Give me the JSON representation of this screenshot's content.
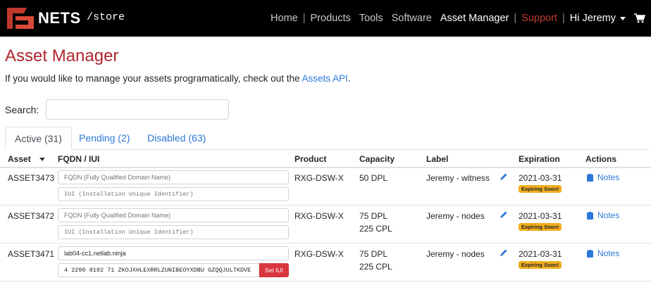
{
  "brand": {
    "logo_text": "NETS",
    "path": "/store"
  },
  "nav": {
    "home": "Home",
    "products": "Products",
    "tools": "Tools",
    "software": "Software",
    "asset_manager": "Asset Manager",
    "support": "Support",
    "user": "Hi Jeremy"
  },
  "page": {
    "title": "Asset Manager",
    "intro_prefix": "If you would like to manage your assets programatically, check out the ",
    "intro_link": "Assets API",
    "intro_suffix": "."
  },
  "search": {
    "label": "Search:",
    "placeholder": "",
    "value": ""
  },
  "tabs": [
    {
      "label": "Active (31)",
      "active": true
    },
    {
      "label": "Pending (2)",
      "active": false
    },
    {
      "label": "Disabled (63)",
      "active": false
    }
  ],
  "table": {
    "headers": {
      "asset": "Asset",
      "fqdn_iui": "FQDN / IUI",
      "product": "Product",
      "capacity": "Capacity",
      "label": "Label",
      "expiration": "Expiration",
      "actions": "Actions"
    },
    "fqdn_placeholder": "FQDN (Fully Qualified Domain Name)",
    "iui_placeholder": "IUI (Installation Unique Identifier)",
    "set_iui_label": "Set IUI",
    "notes_label": "Notes",
    "rows": [
      {
        "asset": "ASSET3473",
        "fqdn": "",
        "iui": "",
        "product": "RXG-DSW-X",
        "capacity1": "50 DPL",
        "capacity2": "",
        "label": "Jeremy - witness",
        "expiration": "2021-03-31",
        "badge": "Expiring Soon!"
      },
      {
        "asset": "ASSET3472",
        "fqdn": "",
        "iui": "",
        "product": "RXG-DSW-X",
        "capacity1": "75 DPL",
        "capacity2": "225 CPL",
        "label": "Jeremy - nodes",
        "expiration": "2021-03-31",
        "badge": "Expiring Soon!"
      },
      {
        "asset": "ASSET3471",
        "fqdn": "lab04-cc1.netlab.ninja",
        "iui": "4 2290 8192 71 ZKOJXHLEXRRLZUNIBEOYXDBU GZQQJULTKDVE",
        "product": "RXG-DSW-X",
        "capacity1": "75 DPL",
        "capacity2": "225 CPL",
        "label": "Jeremy - nodes",
        "expiration": "2021-03-31",
        "badge": "Expiring Soon!"
      }
    ]
  },
  "colors": {
    "brand_red": "#b0262d",
    "link_blue": "#2d78d8",
    "badge_yellow": "#f0ad1e",
    "button_red": "#d9363e"
  }
}
